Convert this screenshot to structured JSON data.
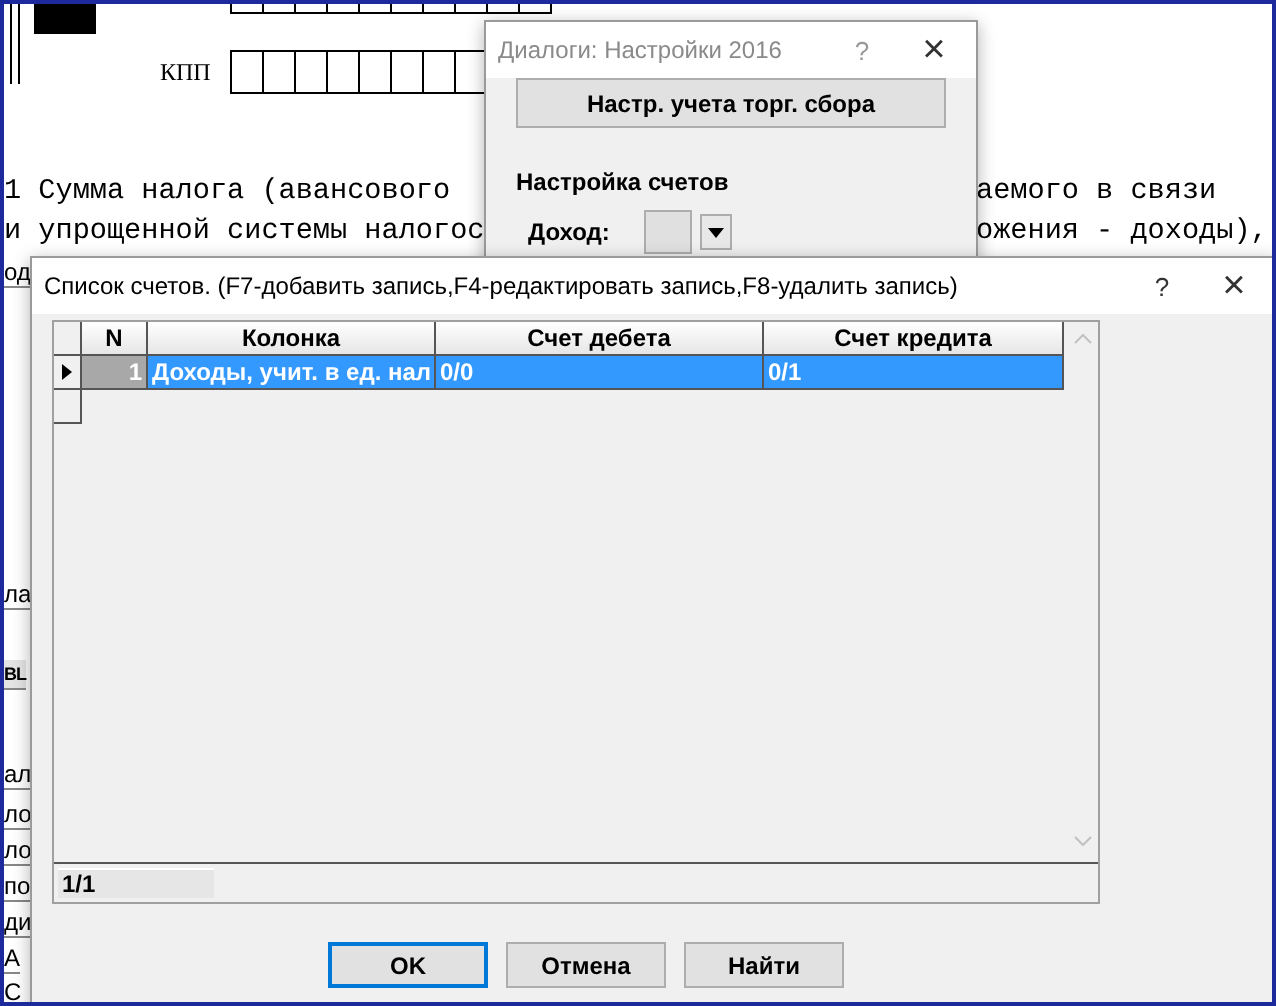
{
  "document": {
    "kpp_label": "КПП",
    "text_lines": [
      {
        "left": "1 Сумма налога (авансового",
        "right": "аемого в связи"
      },
      {
        "left": "и упрощенной системы налогос",
        "right": "ожения - доходы),"
      }
    ],
    "left_fragments": [
      "од",
      "ла",
      "BL",
      "ал",
      "ло",
      "ло",
      "по",
      "ди",
      "А",
      "С"
    ]
  },
  "settings_dialog": {
    "title": "Диалоги: Настройки 2016",
    "help": "?",
    "close": "×",
    "button": "Настр. учета торг. сбора",
    "section": "Настройка счетов",
    "income_label": "Доход:"
  },
  "accounts_dialog": {
    "title": "Список счетов. (F7-добавить запись,F4-редактировать запись,F8-удалить запись)",
    "help": "?",
    "close": "×",
    "table": {
      "columns": [
        "N",
        "Колонка",
        "Счет дебета",
        "Счет кредита"
      ],
      "rows": [
        {
          "cells": [
            "1",
            "Доходы, учит. в ед. нал",
            "0/0",
            "0/1"
          ],
          "selected": true
        }
      ]
    },
    "record_counter": "1/1",
    "buttons": [
      {
        "label": "OK",
        "default": true
      },
      {
        "label": "Отмена",
        "default": false
      },
      {
        "label": "Найти",
        "default": false
      }
    ]
  }
}
